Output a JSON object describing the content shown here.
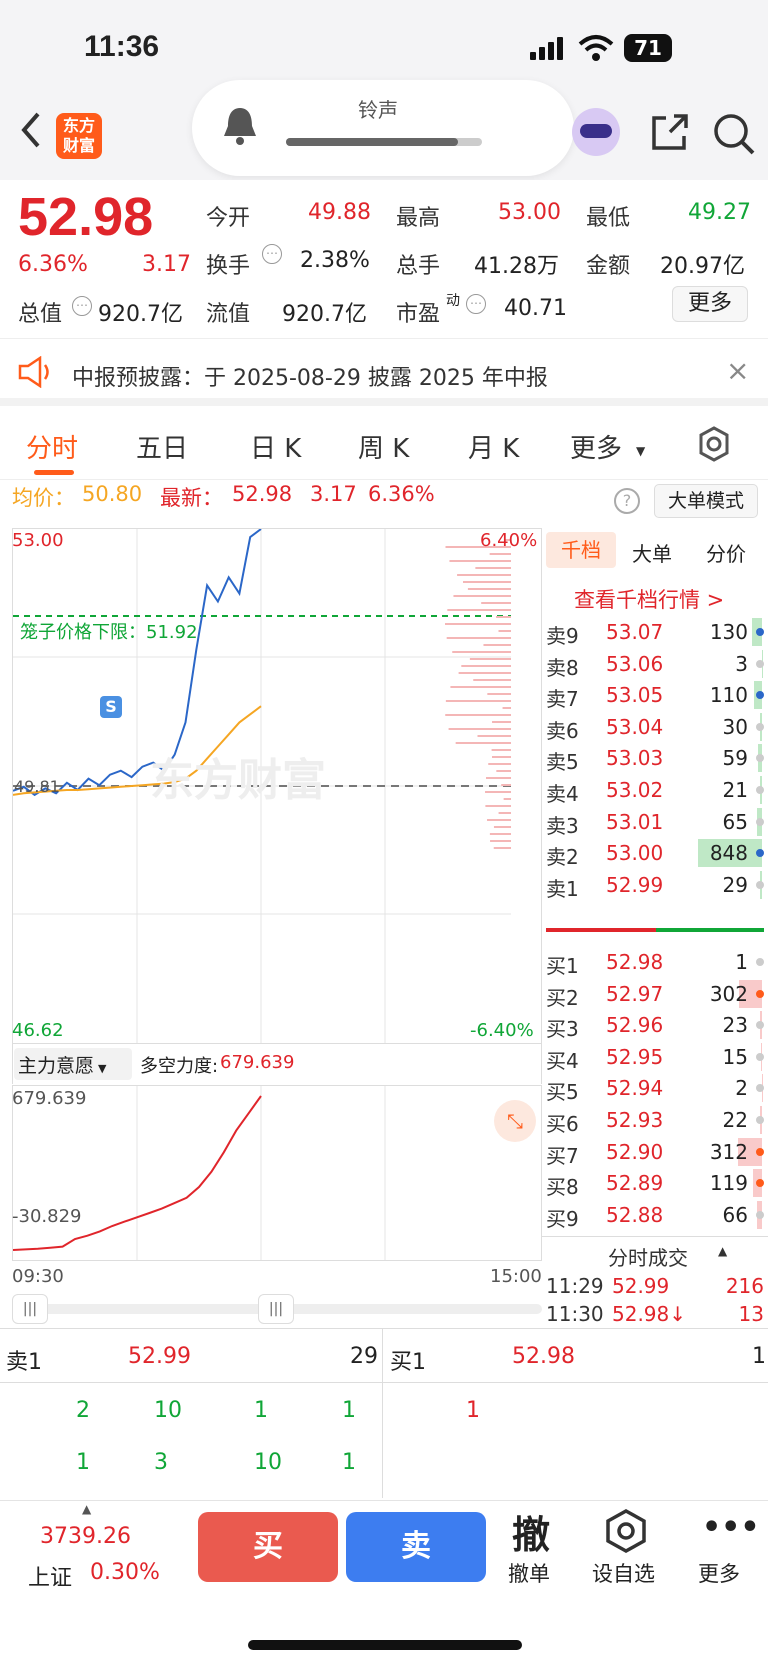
{
  "status": {
    "time": "11:36",
    "battery": "71"
  },
  "header": {
    "back": "<",
    "logo_line1": "东方",
    "logo_line2": "财富",
    "ringtone": "铃声"
  },
  "quote": {
    "price": "52.98",
    "pct": "6.36%",
    "chg": "3.17",
    "open_l": "今开",
    "open_v": "49.88",
    "high_l": "最高",
    "high_v": "53.00",
    "low_l": "最低",
    "low_v": "49.27",
    "turn_l": "换手",
    "turn_v": "2.38%",
    "vol_l": "总手",
    "vol_v": "41.28万",
    "amt_l": "金额",
    "amt_v": "20.97亿",
    "mcap_l": "总值",
    "mcap_v": "920.7亿",
    "float_l": "流值",
    "float_v": "920.7亿",
    "pe_l": "市盈",
    "pe_sup": "动",
    "pe_v": "40.71",
    "more": "更多"
  },
  "notice": {
    "text": "中报预披露：于 2025-08-29 披露 2025 年中报",
    "close": "×"
  },
  "tabs": [
    "分时",
    "五日",
    "日 K",
    "周 K",
    "月 K",
    "更多"
  ],
  "info": {
    "avg_l": "均价：",
    "avg_v": "50.80",
    "last_l": "最新：",
    "last_v": "52.98",
    "chg": "3.17",
    "pct": "6.36%",
    "mode": "大单模式"
  },
  "chart": {
    "top": "53.00",
    "bottom": "46.62",
    "top_pct": "6.40%",
    "bottom_pct": "-6.40%",
    "prev": "49.81",
    "cage": "笼子价格下限：51.92",
    "s_marker": "S",
    "watermark": "东方财富"
  },
  "chart_data": {
    "type": "line",
    "prev_close": 49.81,
    "ylim": [
      46.62,
      53.0
    ],
    "x_range": [
      "09:30",
      "15:00"
    ],
    "series": [
      {
        "name": "price",
        "values": [
          49.75,
          49.8,
          49.7,
          49.78,
          49.72,
          49.85,
          49.76,
          49.9,
          49.82,
          49.95,
          50.0,
          49.92,
          50.05,
          50.1,
          50.0,
          50.2,
          50.6,
          51.5,
          52.3,
          52.1,
          52.4,
          52.2,
          52.9,
          53.0
        ]
      },
      {
        "name": "avg",
        "values": [
          49.7,
          49.72,
          49.73,
          49.74,
          49.75,
          49.76,
          49.76,
          49.77,
          49.78,
          49.79,
          49.8,
          49.81,
          49.82,
          49.83,
          49.84,
          49.86,
          49.9,
          50.0,
          50.15,
          50.3,
          50.45,
          50.6,
          50.7,
          50.8
        ]
      }
    ]
  },
  "sub": {
    "select": "主力意愿",
    "power_l": "多空力度:",
    "power_v": "679.639",
    "max": "679.639",
    "min": "-30.829",
    "t0": "09:30",
    "t1": "15:00",
    "values": [
      -30.8,
      -28,
      -25,
      -20,
      -15,
      20,
      35,
      55,
      80,
      100,
      120,
      140,
      160,
      185,
      210,
      260,
      330,
      420,
      520,
      600,
      679.6
    ]
  },
  "ob": {
    "tabs": [
      "千档",
      "大单",
      "分价"
    ],
    "link": "查看千档行情 >",
    "sells": [
      [
        "卖9",
        "53.07",
        "130"
      ],
      [
        "卖8",
        "53.06",
        "3"
      ],
      [
        "卖7",
        "53.05",
        "110"
      ],
      [
        "卖6",
        "53.04",
        "30"
      ],
      [
        "卖5",
        "53.03",
        "59"
      ],
      [
        "卖4",
        "53.02",
        "21"
      ],
      [
        "卖3",
        "53.01",
        "65"
      ],
      [
        "卖2",
        "53.00",
        "848"
      ],
      [
        "卖1",
        "52.99",
        "29"
      ]
    ],
    "buys": [
      [
        "买1",
        "52.98",
        "1"
      ],
      [
        "买2",
        "52.97",
        "302"
      ],
      [
        "买3",
        "52.96",
        "23"
      ],
      [
        "买4",
        "52.95",
        "15"
      ],
      [
        "买5",
        "52.94",
        "2"
      ],
      [
        "买6",
        "52.93",
        "22"
      ],
      [
        "买7",
        "52.90",
        "312"
      ],
      [
        "买8",
        "52.89",
        "119"
      ],
      [
        "买9",
        "52.88",
        "66"
      ]
    ],
    "trades_title": "分时成交",
    "trades": [
      [
        "11:29",
        "52.99",
        "216"
      ],
      [
        "11:30",
        "52.98↓",
        "13"
      ]
    ]
  },
  "queue": {
    "sell_l": "卖1",
    "sell_p": "52.99",
    "sell_q": "29",
    "buy_l": "买1",
    "buy_p": "52.98",
    "buy_q": "1",
    "sell_rows": [
      [
        "2",
        "10",
        "1",
        "1"
      ],
      [
        "1",
        "3",
        "10",
        "1"
      ]
    ],
    "buy_rows": [
      [
        "1"
      ]
    ]
  },
  "footer": {
    "index_v": "3739.26",
    "index_l": "上证",
    "index_pct": "0.30%",
    "buy": "买",
    "sell": "卖",
    "cancel": "撤单",
    "cancel_icon": "撤",
    "watch": "设自选",
    "more": "更多"
  }
}
